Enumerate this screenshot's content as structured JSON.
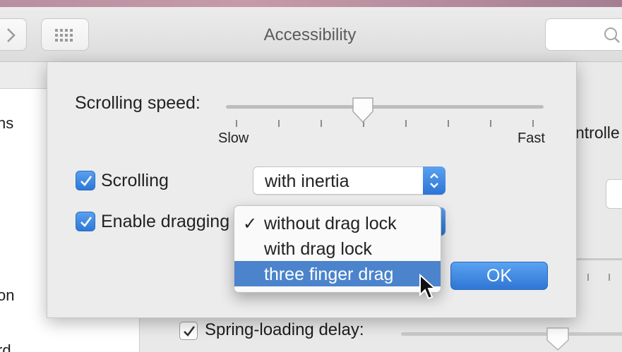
{
  "window": {
    "title": "Accessibility",
    "search_placeholder": ""
  },
  "background": {
    "left_fragments": [
      "ns",
      "on",
      "rd"
    ],
    "right_fragment": "ntrolle",
    "spring_loading": {
      "label": "Spring-loading delay:",
      "checked": true
    }
  },
  "sheet": {
    "scrolling_speed": {
      "label": "Scrolling speed:",
      "min_label": "Slow",
      "max_label": "Fast",
      "value_fraction": 0.43
    },
    "scrolling": {
      "label": "Scrolling",
      "checked": true,
      "selected": "with inertia"
    },
    "dragging": {
      "label": "Enable dragging",
      "checked": true,
      "menu_open": true,
      "options": [
        {
          "label": "without drag lock",
          "checked": true,
          "highlighted": false
        },
        {
          "label": "with drag lock",
          "checked": false,
          "highlighted": false
        },
        {
          "label": "three finger drag",
          "checked": false,
          "highlighted": true
        }
      ],
      "checkmark_glyph": "✓"
    },
    "ok_label": "OK"
  },
  "colors": {
    "accent": "#3a86e0",
    "menu_highlight": "#4b84cc"
  }
}
